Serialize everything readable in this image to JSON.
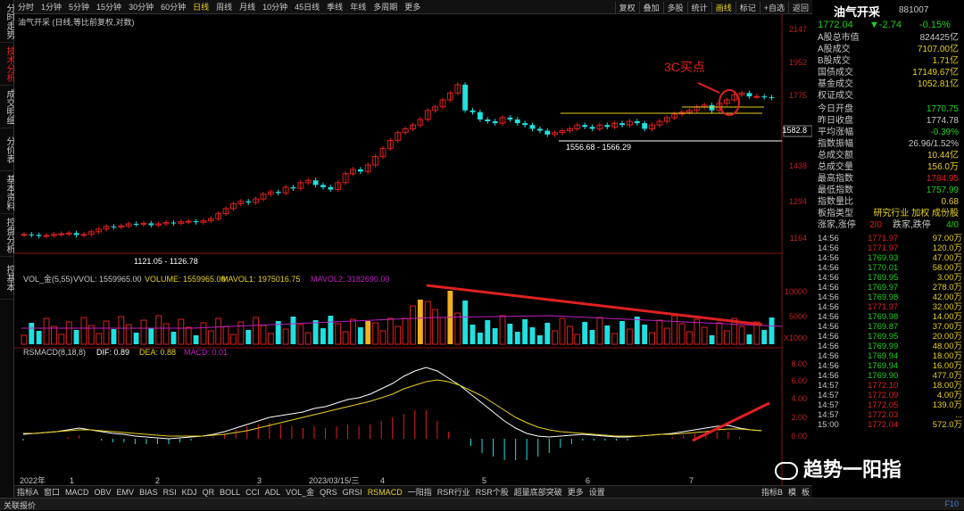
{
  "left_sidebar": [
    "分时走势",
    "技术分析",
    "成交明细",
    "分价表",
    "基本资料",
    "控盘分析",
    "控基本"
  ],
  "left_sidebar_active": 1,
  "toolbar": {
    "periods": [
      "分时",
      "1分钟",
      "5分钟",
      "15分钟",
      "30分钟",
      "60分钟",
      "日线",
      "周线",
      "月线",
      "10分钟",
      "45日线",
      "季线",
      "年线",
      "多周期",
      "更多"
    ],
    "selected": "日线",
    "right": [
      "复权",
      "叠加",
      "多股",
      "统计",
      "画线",
      "标记",
      "+自选",
      "返回"
    ],
    "right_selected": "画线"
  },
  "chart_title": "油气开采 (日线,等比前复权,对数)",
  "price_axis": [
    "2147",
    "1952",
    "1775",
    "1582.8",
    "1438",
    "1294",
    "1164"
  ],
  "vol_legend": {
    "a": "VOL_金(5,55)",
    "b": "VVOL: 1559965.00",
    "c": "VOLUME: 1559965.00",
    "d": "MAVOL1: 1975016.75",
    "e": "MAVOL2: 3182690.00"
  },
  "vol_axis": [
    "10000",
    "5000",
    "X1000"
  ],
  "macd_legend": {
    "a": "RSMACD(8,18,8)",
    "b": "DIF: 0.89",
    "c": "DEA: 0.88",
    "d": "MACD: 0.01"
  },
  "macd_axis": [
    "8.00",
    "6.00",
    "4.00",
    "2.00",
    "0.00"
  ],
  "annotations": {
    "buy": "3C买点",
    "range_high": "1556.68 - 1566.29",
    "range_low": "1121.05 - 1126.78"
  },
  "x_labels": [
    "2022年",
    "1",
    "2",
    "3",
    "2023/03/15/三",
    "4",
    "5",
    "6",
    "7"
  ],
  "bottom_tabs": [
    "指标A",
    "窗口",
    "MACD",
    "OBV",
    "EMV",
    "BIAS",
    "RSI",
    "KDJ",
    "QR",
    "BOLL",
    "CCI",
    "ADL",
    "VOL_金",
    "QRS",
    "GRSI",
    "RSMACD",
    "一阳指",
    "RSR行业",
    "RSR个股",
    "超量底部突破",
    "更多",
    "设置"
  ],
  "bottom_selected": "RSMACD",
  "bottom_right": [
    "指标B",
    "模",
    "板"
  ],
  "status_left": "关联报价",
  "status_right": "F10",
  "watermark": "趋势一阳指",
  "stock": {
    "name": "油气开采",
    "code": "881007",
    "price": "1772.04",
    "change": "▼-2.74",
    "pct": "-0.15%"
  },
  "stats": [
    [
      "A股总市值",
      "824425亿",
      "#c8c8c8"
    ],
    [
      "A股成交",
      "7107.00亿",
      "#e8d020"
    ],
    [
      "B股成交",
      "1.71亿",
      "#e8d020"
    ],
    [
      "国债成交",
      "17149.67亿",
      "#e8d020"
    ],
    [
      "基金成交",
      "1052.81亿",
      "#e8d020"
    ],
    [
      "权证成交",
      "",
      "#e8d020"
    ]
  ],
  "stats2": [
    [
      "今日开盘",
      "1770.75",
      "#20d020"
    ],
    [
      "昨日收盘",
      "1774.78",
      "#c8c8c8"
    ],
    [
      "平均涨幅",
      "-0.39%",
      "#20d020"
    ],
    [
      "指数振幅",
      "26.96/1.52%",
      "#c8c8c8"
    ],
    [
      "总成交额",
      "10.44亿",
      "#e8d020"
    ],
    [
      "总成交量",
      "156.0万",
      "#e8d020"
    ],
    [
      "最高指数",
      "1784.95",
      "#e02020"
    ],
    [
      "最低指数",
      "1757.99",
      "#20d020"
    ],
    [
      "指数量比",
      "0.68",
      "#e8d020"
    ],
    [
      "板指类型",
      "研究行业 加权 成份股",
      "#e8d020"
    ]
  ],
  "updown": {
    "k1": "涨家,涨停",
    "v1": "2/0",
    "k2": "跌家,跌停",
    "v2": "4/0"
  },
  "ticks": [
    [
      "14:56",
      "1771.97",
      "97.00万"
    ],
    [
      "14:56",
      "1771.97",
      "120.0万"
    ],
    [
      "14:56",
      "1769.93",
      "47.00万"
    ],
    [
      "14:56",
      "1770.01",
      "58.00万"
    ],
    [
      "14:56",
      "1769.95",
      "3.00万"
    ],
    [
      "14:56",
      "1769.97",
      "278.0万"
    ],
    [
      "14:56",
      "1769.98",
      "42.00万"
    ],
    [
      "14:56",
      "1771.97",
      "32.00万"
    ],
    [
      "14:56",
      "1769.98",
      "14.00万"
    ],
    [
      "14:56",
      "1769.87",
      "37.00万"
    ],
    [
      "14:56",
      "1769.95",
      "20.00万"
    ],
    [
      "14:56",
      "1769.99",
      "48.00万"
    ],
    [
      "14:56",
      "1769.94",
      "18.00万"
    ],
    [
      "14:56",
      "1769.94",
      "16.00万"
    ],
    [
      "14:56",
      "1769.90",
      "477.0万"
    ],
    [
      "14:57",
      "1772.10",
      "18.00万"
    ],
    [
      "14:57",
      "1772.09",
      "4.00万"
    ],
    [
      "14:57",
      "1772.05",
      "139.0万"
    ],
    [
      "14:57",
      "1772.03",
      "..."
    ],
    [
      "15:00",
      "1772.04",
      "572.0万"
    ]
  ],
  "colors": {
    "up": "#e02020",
    "down": "#20e0e0",
    "yellow": "#e8d020",
    "white": "#ffffff",
    "purple": "#c020c0",
    "green": "#20d020"
  },
  "chart_data": {
    "type": "candlestick",
    "closes": [
      1130,
      1128,
      1124,
      1126,
      1130,
      1132,
      1135,
      1128,
      1130,
      1140,
      1150,
      1160,
      1158,
      1162,
      1170,
      1168,
      1172,
      1165,
      1170,
      1175,
      1172,
      1178,
      1180,
      1176,
      1182,
      1190,
      1210,
      1230,
      1250,
      1260,
      1255,
      1270,
      1290,
      1300,
      1295,
      1320,
      1315,
      1340,
      1350,
      1330,
      1320,
      1310,
      1340,
      1380,
      1400,
      1390,
      1420,
      1460,
      1500,
      1540,
      1580,
      1600,
      1620,
      1650,
      1700,
      1720,
      1760,
      1800,
      1850,
      1700,
      1690,
      1650,
      1640,
      1630,
      1660,
      1650,
      1630,
      1620,
      1600,
      1590,
      1570,
      1580,
      1590,
      1600,
      1620,
      1610,
      1600,
      1620,
      1610,
      1630,
      1620,
      1640,
      1630,
      1600,
      1620,
      1640,
      1660,
      1680,
      1690,
      1700,
      1720,
      1730,
      1700,
      1740,
      1760,
      1790,
      1800,
      1780,
      1780,
      1775,
      1772
    ],
    "macd_dif": [
      0.5,
      0.6,
      0.7,
      0.8,
      1.0,
      1.2,
      1.0,
      0.8,
      0.6,
      0.5,
      0.3,
      0.2,
      0.1,
      0,
      0.1,
      0.2,
      0.3,
      0.5,
      0.8,
      1.2,
      1.6,
      2.0,
      2.4,
      2.6,
      2.8,
      3.0,
      3.4,
      3.6,
      4.0,
      4.4,
      4.6,
      5.0,
      5.6,
      6.2,
      7.0,
      7.6,
      8.0,
      7.6,
      6.8,
      6.0,
      5.0,
      4.0,
      3.0,
      2.0,
      1.2,
      0.6,
      0.3,
      0.2,
      0.3,
      0.4,
      0.5,
      0.4,
      0.3,
      0.2,
      0.2,
      0.3,
      0.4,
      0.5,
      0.6,
      0.8,
      1.0,
      1.2,
      1.4,
      1.5,
      1.2,
      1.0,
      0.9
    ],
    "macd_dea": [
      0.6,
      0.6,
      0.7,
      0.8,
      0.9,
      1.0,
      1.0,
      0.9,
      0.8,
      0.7,
      0.6,
      0.5,
      0.4,
      0.3,
      0.3,
      0.3,
      0.3,
      0.4,
      0.5,
      0.7,
      0.9,
      1.2,
      1.5,
      1.8,
      2.1,
      2.4,
      2.7,
      3.0,
      3.3,
      3.6,
      3.9,
      4.2,
      4.6,
      5.0,
      5.6,
      6.0,
      6.4,
      6.6,
      6.4,
      6.0,
      5.4,
      4.8,
      4.0,
      3.2,
      2.4,
      1.8,
      1.3,
      1.0,
      0.8,
      0.7,
      0.6,
      0.5,
      0.4,
      0.3,
      0.3,
      0.3,
      0.4,
      0.5,
      0.5,
      0.6,
      0.7,
      0.8,
      1.0,
      1.1,
      1.1,
      1.0,
      0.9
    ]
  }
}
